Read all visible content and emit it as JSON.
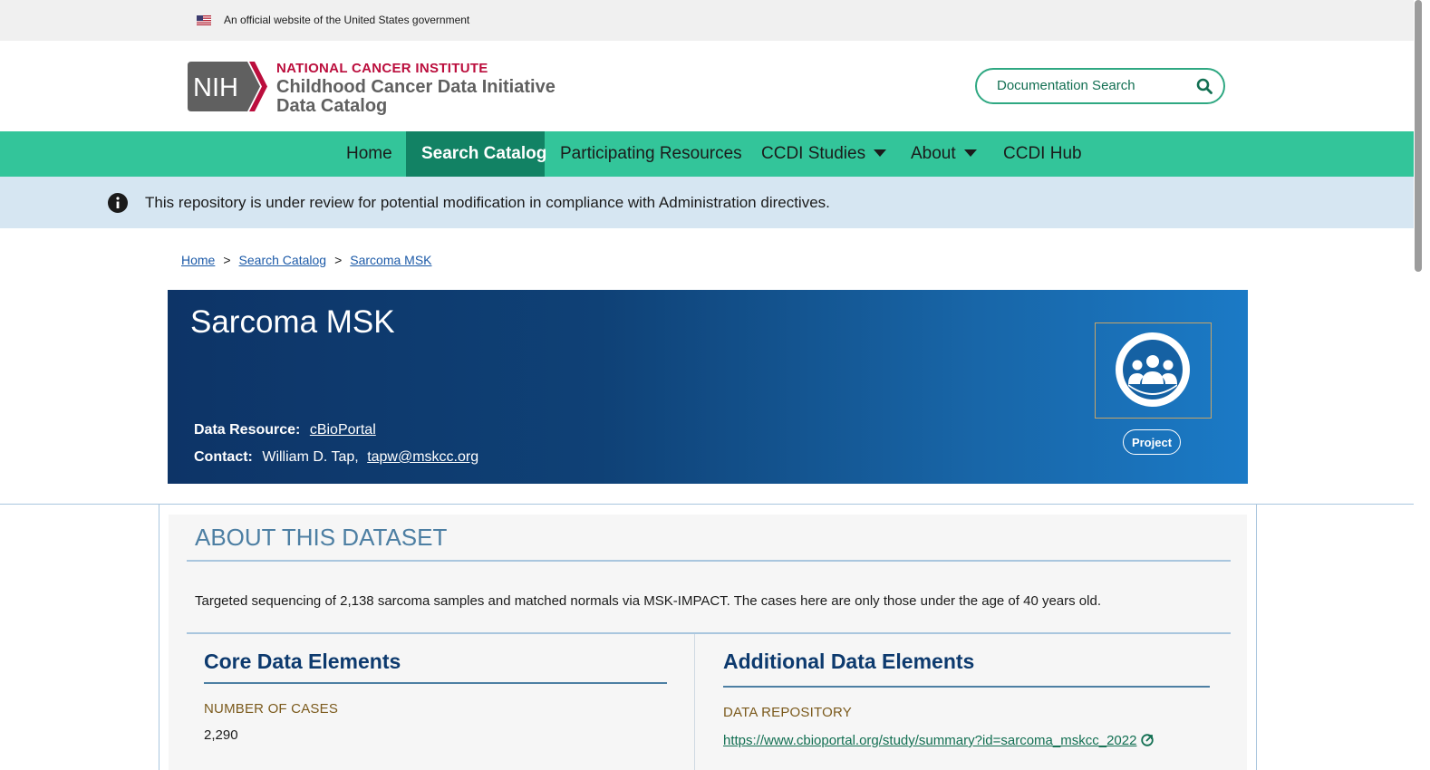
{
  "gov_banner": {
    "text": "An official website of the United States government"
  },
  "header": {
    "logo_mark": "NIH",
    "institute": "NATIONAL CANCER INSTITUTE",
    "title_line1": "Childhood Cancer Data Initiative",
    "title_line2": "Data Catalog",
    "search_placeholder": "Documentation Search"
  },
  "nav": {
    "items": [
      {
        "label": "Home"
      },
      {
        "label": "Search Catalog"
      },
      {
        "label": "Participating Resources"
      },
      {
        "label": "CCDI Studies"
      },
      {
        "label": "About"
      },
      {
        "label": "CCDI Hub"
      }
    ],
    "active": "Search Catalog"
  },
  "alert": {
    "message": "This repository is under review for potential modification in compliance with Administration directives."
  },
  "breadcrumb": {
    "items": [
      "Home",
      "Search Catalog",
      "Sarcoma MSK"
    ],
    "separator": ">"
  },
  "dataset": {
    "title": "Sarcoma MSK",
    "resource_label": "Data Resource:",
    "resource_value": "cBioPortal",
    "contact_label": "Contact:",
    "contact_name": "William D. Tap,",
    "contact_email": "tapw@mskcc.org",
    "type_badge": "Project"
  },
  "about": {
    "heading": "ABOUT THIS DATASET",
    "description": "Targeted sequencing of 2,138 sarcoma samples and matched normals via MSK-IMPACT. The cases here are only those under the age of 40 years old.",
    "core": {
      "heading": "Core Data Elements",
      "fields": [
        {
          "label": "NUMBER OF CASES",
          "value": "2,290"
        }
      ]
    },
    "additional": {
      "heading": "Additional Data Elements",
      "fields": [
        {
          "label": "DATA REPOSITORY",
          "value": "https://www.cbioportal.org/study/summary?id=sarcoma_mskcc_2022"
        }
      ]
    }
  },
  "colors": {
    "nav_bg": "#33c59a",
    "nav_active": "#128264",
    "alert_bg": "#d6e6f2",
    "hero_start": "#0d3467",
    "hero_end": "#1b7ac6",
    "brand_red": "#bb0e3d"
  }
}
